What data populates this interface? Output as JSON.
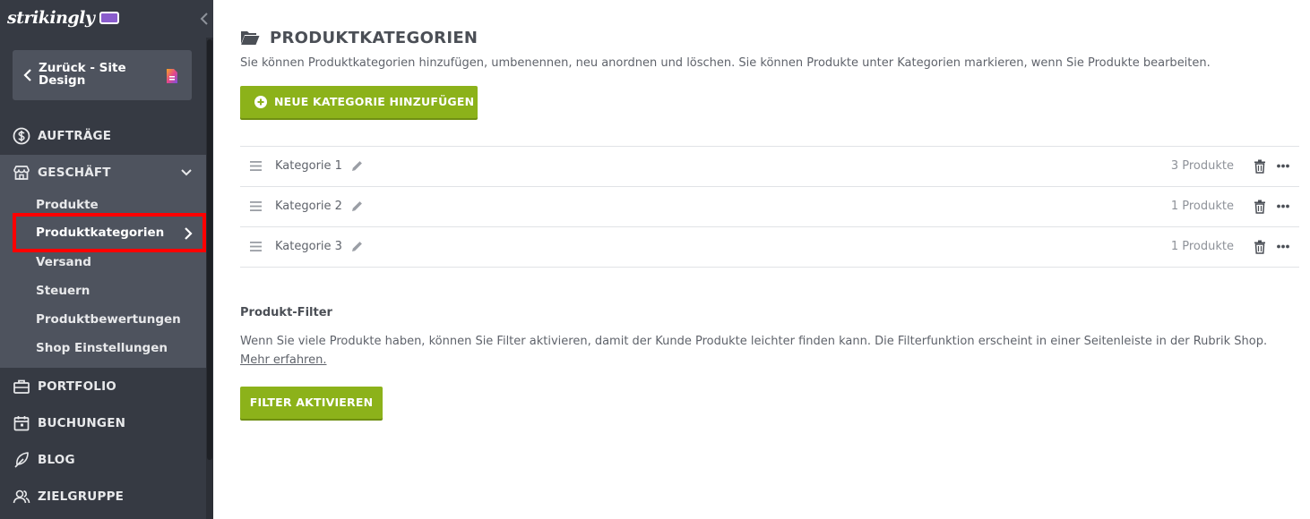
{
  "app": {
    "logo_text": "strikingly",
    "accent_color": "#8cb21a",
    "sidebar_bg": "#363a43",
    "highlight_color": "#ff0000"
  },
  "sidebar": {
    "back_button": {
      "label": "Zurück - Site Design",
      "icon": "page-icon"
    },
    "items": [
      {
        "label": "AUFTRÄGE",
        "icon": "dollar-circle-icon"
      },
      {
        "label": "GESCHÄFT",
        "icon": "store-icon",
        "expanded": true
      },
      {
        "label": "PORTFOLIO",
        "icon": "briefcase-icon"
      },
      {
        "label": "BUCHUNGEN",
        "icon": "calendar-icon"
      },
      {
        "label": "BLOG",
        "icon": "feather-icon"
      },
      {
        "label": "ZIELGRUPPE",
        "icon": "users-icon"
      }
    ],
    "subitems": [
      "Produkte",
      "Produktkategorien",
      "Versand",
      "Steuern",
      "Produktbewertungen",
      "Shop Einstellungen"
    ],
    "active_subitem": "Produktkategorien"
  },
  "main": {
    "title": "PRODUKTKATEGORIEN",
    "description": "Sie können Produktkategorien hinzufügen, umbenennen, neu anordnen und löschen. Sie können Produkte unter Kategorien markieren, wenn Sie Produkte bearbeiten.",
    "add_button": "NEUE KATEGORIE HINZUFÜGEN",
    "categories": [
      {
        "name": "Kategorie 1",
        "count": "3 Produkte"
      },
      {
        "name": "Kategorie 2",
        "count": "1 Produkte"
      },
      {
        "name": "Kategorie 3",
        "count": "1 Produkte"
      }
    ],
    "filter": {
      "title": "Produkt-Filter",
      "description": "Wenn Sie viele Produkte haben, können Sie Filter aktivieren, damit der Kunde Produkte leichter finden kann. Die Filterfunktion erscheint in einer Seitenleiste in der Rubrik Shop.",
      "link": "Mehr erfahren.",
      "button": "FILTER AKTIVIEREN"
    }
  }
}
